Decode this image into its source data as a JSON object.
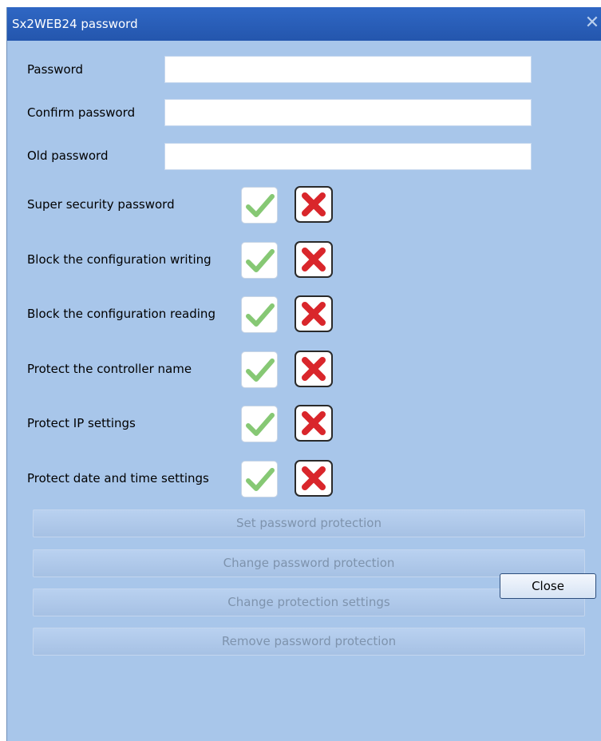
{
  "window": {
    "title": "Sx2WEB24 password",
    "close_glyph": "✕"
  },
  "fields": [
    {
      "label": "Password",
      "value": ""
    },
    {
      "label": "Confirm password",
      "value": ""
    },
    {
      "label": "Old password",
      "value": ""
    }
  ],
  "options": [
    {
      "label": "Super security password",
      "yes_icon": "checkmark-icon",
      "no_icon": "red-x-icon"
    },
    {
      "label": "Block the configuration writing",
      "yes_icon": "checkmark-icon",
      "no_icon": "red-x-icon"
    },
    {
      "label": "Block the configuration reading",
      "yes_icon": "checkmark-icon",
      "no_icon": "red-x-icon"
    },
    {
      "label": "Protect the controller name",
      "yes_icon": "checkmark-icon",
      "no_icon": "red-x-icon"
    },
    {
      "label": "Protect IP settings",
      "yes_icon": "checkmark-icon",
      "no_icon": "red-x-icon"
    },
    {
      "label": "Protect date and time settings",
      "yes_icon": "checkmark-icon",
      "no_icon": "red-x-icon"
    }
  ],
  "actions": [
    {
      "label": "Set password protection",
      "enabled": false
    },
    {
      "label": "Change password protection",
      "enabled": false
    },
    {
      "label": "Change protection settings",
      "enabled": false
    },
    {
      "label": "Remove password protection",
      "enabled": false
    }
  ],
  "footer": {
    "close_label": "Close"
  },
  "colors": {
    "titlebar": "#2456ad",
    "dialog_bg": "#a8c6ea",
    "check_green": "#7cc46b",
    "cross_red": "#d9262b",
    "disabled_text": "#7e93ad"
  }
}
